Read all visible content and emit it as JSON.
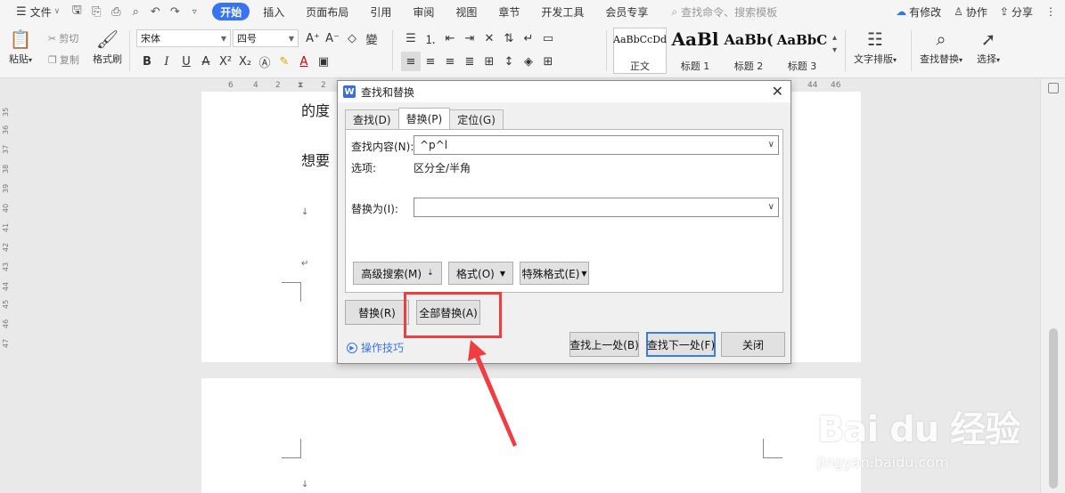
{
  "menubar": {
    "file": "文件",
    "tabs": [
      "开始",
      "插入",
      "页面布局",
      "引用",
      "审阅",
      "视图",
      "章节",
      "开发工具",
      "会员专享"
    ],
    "search_placeholder": "查找命令、搜索模板",
    "right": {
      "changes": "有修改",
      "collab": "协作",
      "share": "分享"
    }
  },
  "ribbon": {
    "paste": "粘贴",
    "cut": "剪切",
    "copy": "复制",
    "format_painter": "格式刷",
    "font_name": "宋体",
    "font_size": "四号",
    "styles": [
      {
        "sample": "AaBbCcDd",
        "label": "正文"
      },
      {
        "sample": "AaBl",
        "label": "标题 1"
      },
      {
        "sample": "AaBb(",
        "label": "标题 2"
      },
      {
        "sample": "AaBbC",
        "label": "标题 3"
      }
    ],
    "text_layout": "文字排版",
    "find_replace": "查找替换",
    "select": "选择"
  },
  "ruler": {
    "ticks": [
      "6",
      "4",
      "2",
      "2",
      "44",
      "46"
    ]
  },
  "vruler": {
    "ticks": [
      "35",
      "36",
      "37",
      "38",
      "39",
      "40",
      "41",
      "42",
      "43",
      "44",
      "45",
      "46",
      "47",
      "48"
    ]
  },
  "document": {
    "line1": "的度",
    "line2": "想要"
  },
  "dialog": {
    "title": "查找和替换",
    "tabs": [
      "查找(D)",
      "替换(P)",
      "定位(G)"
    ],
    "find_label": "查找内容(N):",
    "find_value": "^p^l",
    "options_label": "选项:",
    "options_value": "区分全/半角",
    "replace_label": "替换为(I):",
    "replace_value": "",
    "advanced": "高级搜索(M)",
    "format": "格式(O)",
    "special": "特殊格式(E)",
    "replace_btn": "替换(R)",
    "replace_all_btn": "全部替换(A)",
    "find_prev": "查找上一处(B)",
    "find_next": "查找下一处(F)",
    "close": "关闭",
    "tips": "操作技巧"
  },
  "watermark": {
    "main": "Bai du 经验",
    "sub": "jingyan.baidu.com"
  },
  "colors": {
    "accent": "#3874f2",
    "highlight": "#ef3e42"
  }
}
